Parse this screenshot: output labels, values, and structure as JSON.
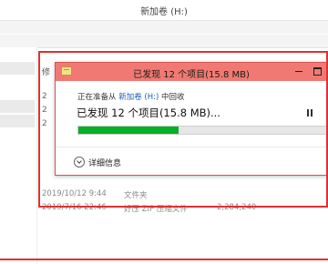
{
  "window": {
    "title": "新加卷 (H:)"
  },
  "background": {
    "header_fragment": "修",
    "edge_fragments": [
      "2",
      "2",
      "2"
    ],
    "rows": [
      {
        "date": "2019/10/12 9:44",
        "type": "文件夹",
        "size": ""
      },
      {
        "date": "2019/7/16 22:46",
        "type": "好压 ZIP 压缩文件",
        "size": "2,284,240"
      }
    ]
  },
  "dialog": {
    "title": "已发现 12 个项目(15.8 MB)",
    "status_prefix": "正在准备从",
    "source_drive": "新加卷 (H:)",
    "status_suffix": "中回收",
    "headline": "已发现 12 个项目(15.8 MB)...",
    "progress_fraction": 0.4,
    "details_label": "详细信息",
    "pause_icon": "pause-icon",
    "minimize_icon": "minimize-icon",
    "maximize_icon": "maximize-icon"
  },
  "colors": {
    "highlight": "#e03030",
    "dialog_title_bg": "#f07a73",
    "progress": "#06b025",
    "link": "#1a5fb4"
  }
}
